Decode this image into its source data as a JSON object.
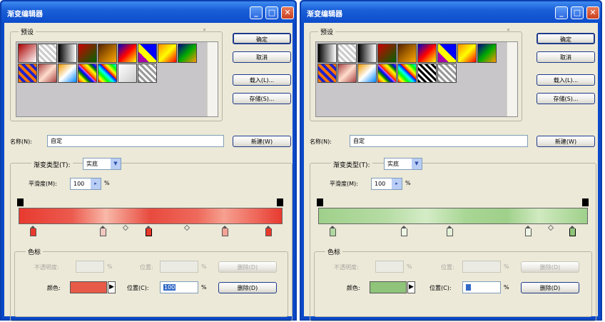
{
  "windows": [
    {
      "id": "left",
      "title": "渐变编辑器",
      "presets_label": "预设",
      "buttons": {
        "ok": "确定",
        "cancel": "取消",
        "load": "载入(L)...",
        "save": "存储(S)...",
        "new": "新建(W)",
        "delete_opacity": "删除(D)",
        "delete_color": "删除(D)"
      },
      "name_label": "名称(N):",
      "name_value": "自定",
      "gradient_type_label": "渐变类型(T):",
      "gradient_type_value": "实底",
      "smoothness_label": "平滑度(M):",
      "smoothness_value": "100",
      "percent": "%",
      "stops_label": "色标",
      "opacity_label": "不透明度:",
      "location_label": "位置:",
      "color_label": "颜色:",
      "location_c_label": "位置(C):",
      "location_c_value": "100",
      "color_stop_color": "#e85a48",
      "accent": "#e8392b"
    },
    {
      "id": "right",
      "title": "渐变编辑器",
      "presets_label": "预设",
      "buttons": {
        "ok": "确定",
        "cancel": "取消",
        "load": "载入(L)...",
        "save": "存储(S)...",
        "new": "新建(W)",
        "delete_opacity": "删除(D)",
        "delete_color": "删除(D)"
      },
      "name_label": "名称(N):",
      "name_value": "自定",
      "gradient_type_label": "渐变类型(T):",
      "gradient_type_value": "实底",
      "smoothness_label": "平滑度(M):",
      "smoothness_value": "100",
      "percent": "%",
      "stops_label": "色标",
      "opacity_label": "不透明度:",
      "location_label": "位置:",
      "color_label": "颜色:",
      "location_c_label": "位置(C):",
      "location_c_value": "",
      "color_stop_color": "#8fc47a",
      "accent": "#9fd08a"
    }
  ]
}
